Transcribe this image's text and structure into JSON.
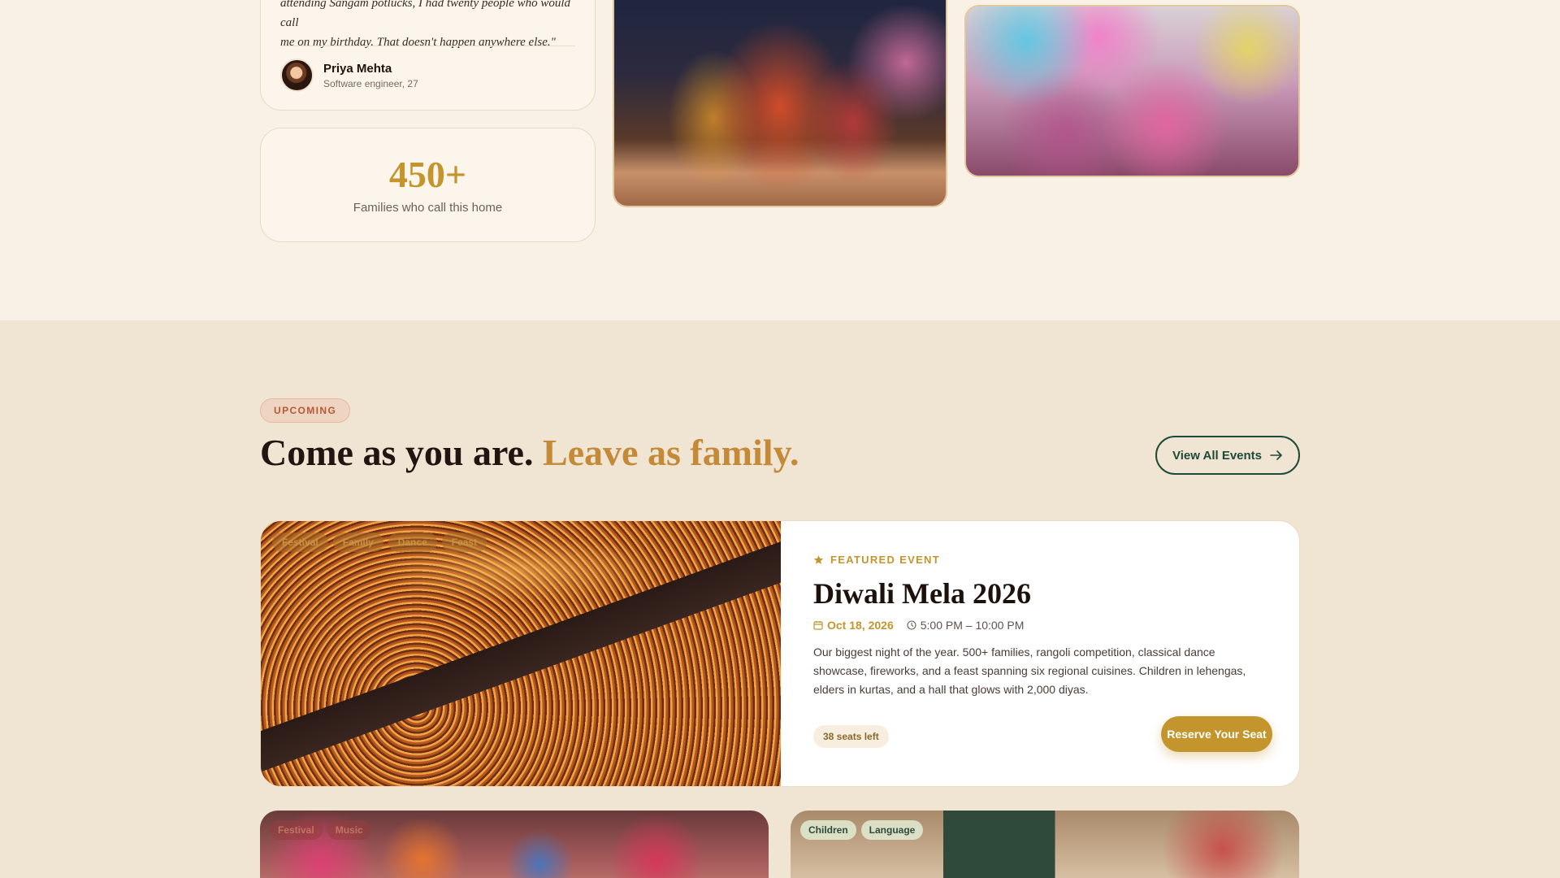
{
  "testimonial": {
    "quote_line1": "attending Sangam potlucks, I had twenty people who would call",
    "quote_line2": "me on my birthday. That doesn't happen anywhere else.\"",
    "author_name": "Priya Mehta",
    "author_role": "Software engineer, 27"
  },
  "stat": {
    "value": "450+",
    "label": "Families who call this home"
  },
  "events": {
    "tag": "UPCOMING",
    "headline_main": "Come as you are.",
    "headline_accent": "Leave as family.",
    "view_all_label": "View All Events",
    "featured": {
      "label": "FEATURED EVENT",
      "title": "Diwali Mela 2026",
      "date": "Oct 18, 2026",
      "time": "5:00 PM – 10:00 PM",
      "description": "Our biggest night of the year. 500+ families, rangoli competition, classical dance showcase, fireworks, and a feast spanning six regional cuisines. Children in lehengas, elders in kurtas, and a hall that glows with 2,000 diyas.",
      "seats": "38 seats left",
      "cta": "Reserve Your Seat",
      "tags": [
        "Festival",
        "Family",
        "Dance",
        "Feast"
      ]
    },
    "mini_cards": [
      {
        "tags": [
          "Festival",
          "Music"
        ]
      },
      {
        "tags": [
          "Children",
          "Language"
        ]
      }
    ]
  },
  "colors": {
    "gold": "#c3952c",
    "accent_text": "#c48a38",
    "green": "#1f4a3a",
    "cream": "#f9f1e5",
    "section_bg": "#f0e4d3"
  },
  "icons": {
    "featured": "star-icon",
    "date": "calendar-icon",
    "time": "clock-icon",
    "view_all": "arrow-right-icon"
  }
}
